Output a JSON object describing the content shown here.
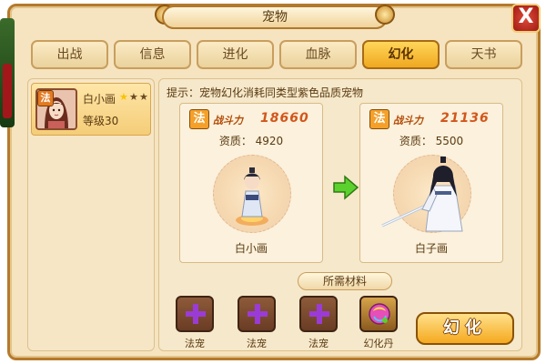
{
  "window": {
    "title": "宠物",
    "close_label": "X"
  },
  "tabs": [
    {
      "label": "出战",
      "active": false
    },
    {
      "label": "信息",
      "active": false
    },
    {
      "label": "进化",
      "active": false
    },
    {
      "label": "血脉",
      "active": false
    },
    {
      "label": "幻化",
      "active": true
    },
    {
      "label": "天书",
      "active": false
    }
  ],
  "pet_list": [
    {
      "name": "白小画",
      "level": "等级30",
      "type_badge": "法",
      "stars_filled": 1,
      "stars_total": 3
    }
  ],
  "hint": "提示：宠物幻化消耗同类型紫色品质宠物",
  "current_pet": {
    "type_badge": "法",
    "power_label": "战斗力",
    "power": "18660",
    "quality": "资质： 4920",
    "name": "白小画"
  },
  "result_pet": {
    "type_badge": "法",
    "power_label": "战斗力",
    "power": "21136",
    "quality": "资质： 5500",
    "name": "白子画"
  },
  "materials": {
    "label": "所需材料",
    "items": [
      {
        "label": "法宠",
        "icon": "plus-icon"
      },
      {
        "label": "法宠",
        "icon": "plus-icon"
      },
      {
        "label": "法宠",
        "icon": "plus-icon"
      },
      {
        "label": "幻化丹",
        "icon": "pill-icon"
      }
    ]
  },
  "action": {
    "label": "幻化"
  },
  "colors": {
    "accent": "#f5a91f",
    "frame": "#b57a2c",
    "power_text": "#d2561b",
    "plus": "#9b3bd6"
  }
}
